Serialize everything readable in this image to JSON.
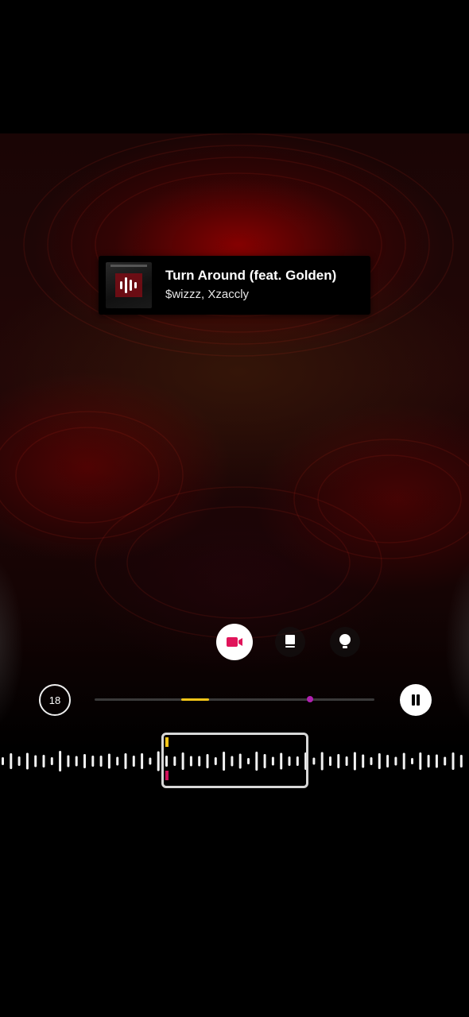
{
  "song": {
    "title": "Turn Around (feat. Golden)",
    "artists": "$wizzz, Xzaccly"
  },
  "duration": {
    "seconds_label": "18"
  },
  "song_progress": {
    "selected_start_fraction": 0.31,
    "selected_end_fraction": 0.41,
    "playhead_fraction": 0.77
  },
  "sticker_styles": [
    {
      "name": "video",
      "icon": "video-camera-icon",
      "selected": true
    },
    {
      "name": "card",
      "icon": "card-icon",
      "selected": false
    },
    {
      "name": "bulb",
      "icon": "lightbulb-icon",
      "selected": false
    }
  ],
  "colors": {
    "accent_pink": "#e0145a",
    "range_yellow": "#f5c518",
    "playhead_purple": "#b020b0",
    "artwork_red": "#8a0000"
  }
}
